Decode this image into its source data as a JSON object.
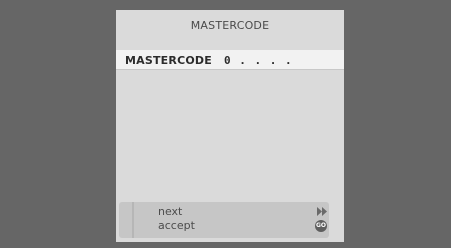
{
  "menu": {
    "title": "MASTERCODE",
    "field": {
      "label": "MASTERCODE",
      "value": "0 . . . ."
    }
  },
  "footer": {
    "hints": [
      {
        "label": "next",
        "icon": "fast-forward-icon"
      },
      {
        "label": "accept",
        "icon": "go-icon",
        "icon_text": "GO"
      }
    ]
  },
  "colors": {
    "background": "#666666",
    "panel": "#dadada",
    "highlight_row": "#f2f2f2",
    "footer": "#c6c6c6"
  }
}
